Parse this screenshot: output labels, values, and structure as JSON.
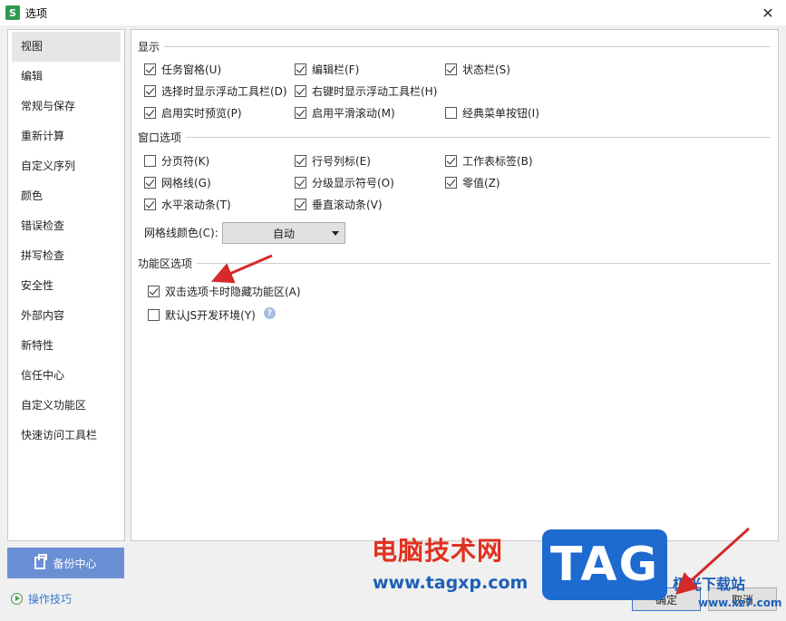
{
  "window": {
    "title": "选项",
    "app_icon_letter": "S"
  },
  "sidebar": {
    "items": [
      {
        "label": "视图",
        "active": true
      },
      {
        "label": "编辑"
      },
      {
        "label": "常规与保存"
      },
      {
        "label": "重新计算"
      },
      {
        "label": "自定义序列"
      },
      {
        "label": "颜色"
      },
      {
        "label": "错误检查"
      },
      {
        "label": "拼写检查"
      },
      {
        "label": "安全性"
      },
      {
        "label": "外部内容"
      },
      {
        "label": "新特性"
      },
      {
        "label": "信任中心"
      },
      {
        "label": "自定义功能区"
      },
      {
        "label": "快速访问工具栏"
      }
    ],
    "backup_label": "备份中心",
    "tips_label": "操作技巧"
  },
  "display": {
    "title": "显示",
    "options": [
      {
        "label": "任务窗格(U)",
        "checked": true
      },
      {
        "label": "编辑栏(F)",
        "checked": true
      },
      {
        "label": "状态栏(S)",
        "checked": true
      },
      {
        "label": "选择时显示浮动工具栏(D)",
        "checked": true
      },
      {
        "label": "右键时显示浮动工具栏(H)",
        "checked": true
      },
      {
        "label": "启用实时预览(P)",
        "checked": true
      },
      {
        "label": "启用平滑滚动(M)",
        "checked": true
      },
      {
        "label": "经典菜单按钮(I)",
        "checked": false
      }
    ]
  },
  "window_options": {
    "title": "窗口选项",
    "options": [
      {
        "label": "分页符(K)",
        "checked": false
      },
      {
        "label": "行号列标(E)",
        "checked": true
      },
      {
        "label": "工作表标签(B)",
        "checked": true
      },
      {
        "label": "网格线(G)",
        "checked": true
      },
      {
        "label": "分级显示符号(O)",
        "checked": true
      },
      {
        "label": "零值(Z)",
        "checked": true
      },
      {
        "label": "水平滚动条(T)",
        "checked": true
      },
      {
        "label": "垂直滚动条(V)",
        "checked": true
      }
    ],
    "grid_color_label": "网格线颜色(C):",
    "grid_color_value": "自动"
  },
  "ribbon_options": {
    "title": "功能区选项",
    "options": [
      {
        "label": "双击选项卡时隐藏功能区(A)",
        "checked": true
      },
      {
        "label": "默认JS开发环境(Y)",
        "checked": false
      }
    ]
  },
  "footer": {
    "ok_label": "确定",
    "cancel_label": "取消"
  },
  "watermark": {
    "site_name": "电脑技术网",
    "site_url": "www.tagxp.com",
    "logo": "TAG",
    "site2_name": "极光下载站",
    "site2_url": "www.xz7.com"
  },
  "colors": {
    "accent": "#6b8fd4",
    "arrow": "#d42a2a",
    "check_green": "#2e9a4e"
  }
}
